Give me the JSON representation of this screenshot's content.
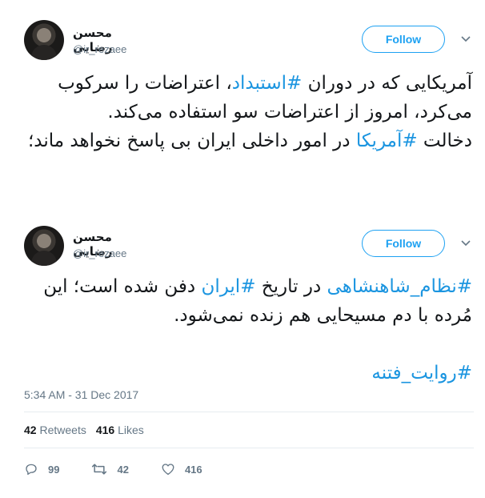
{
  "tweets": [
    {
      "author": {
        "name": "محسن رضایی",
        "handle": "@ir_rezaee"
      },
      "follow_label": "Follow",
      "text_segments": [
        {
          "text": "آمریکایی که در دوران ",
          "hashtag": false
        },
        {
          "text": "#استبداد",
          "hashtag": true
        },
        {
          "text": "، اعتراضات را سرکوب می‌کرد، امروز از اعتراضات سو استفاده می‌کند.\nدخالت ",
          "hashtag": false
        },
        {
          "text": "#آمریکا",
          "hashtag": true
        },
        {
          "text": " در امور داخلی ایران بی پاسخ نخواهد ماند؛",
          "hashtag": false
        }
      ]
    },
    {
      "author": {
        "name": "محسن رضایی",
        "handle": "@ir_rezaee"
      },
      "follow_label": "Follow",
      "text_segments": [
        {
          "text": "#نظام_شاهنشاهی",
          "hashtag": true
        },
        {
          "text": " در تاریخ ",
          "hashtag": false
        },
        {
          "text": "#ایران",
          "hashtag": true
        },
        {
          "text": " دفن شده است؛ این مُرده با دم مسیحایی هم زنده نمی‌شود.\n\n",
          "hashtag": false
        },
        {
          "text": "#روایت_فتنه",
          "hashtag": true
        }
      ],
      "timestamp": "5:34 AM - 31 Dec 2017",
      "stats": {
        "retweets_count": "42",
        "retweets_label": "Retweets",
        "likes_count": "416",
        "likes_label": "Likes"
      },
      "actions": {
        "replies": "99",
        "retweets": "42",
        "likes": "416"
      }
    }
  ],
  "colors": {
    "accent": "#1da1f2",
    "hashtag": "#1b95e0",
    "muted": "#657786",
    "divider": "#e6ecf0"
  },
  "icons": [
    "chevron-down-icon",
    "reply-icon",
    "retweet-icon",
    "heart-icon"
  ]
}
